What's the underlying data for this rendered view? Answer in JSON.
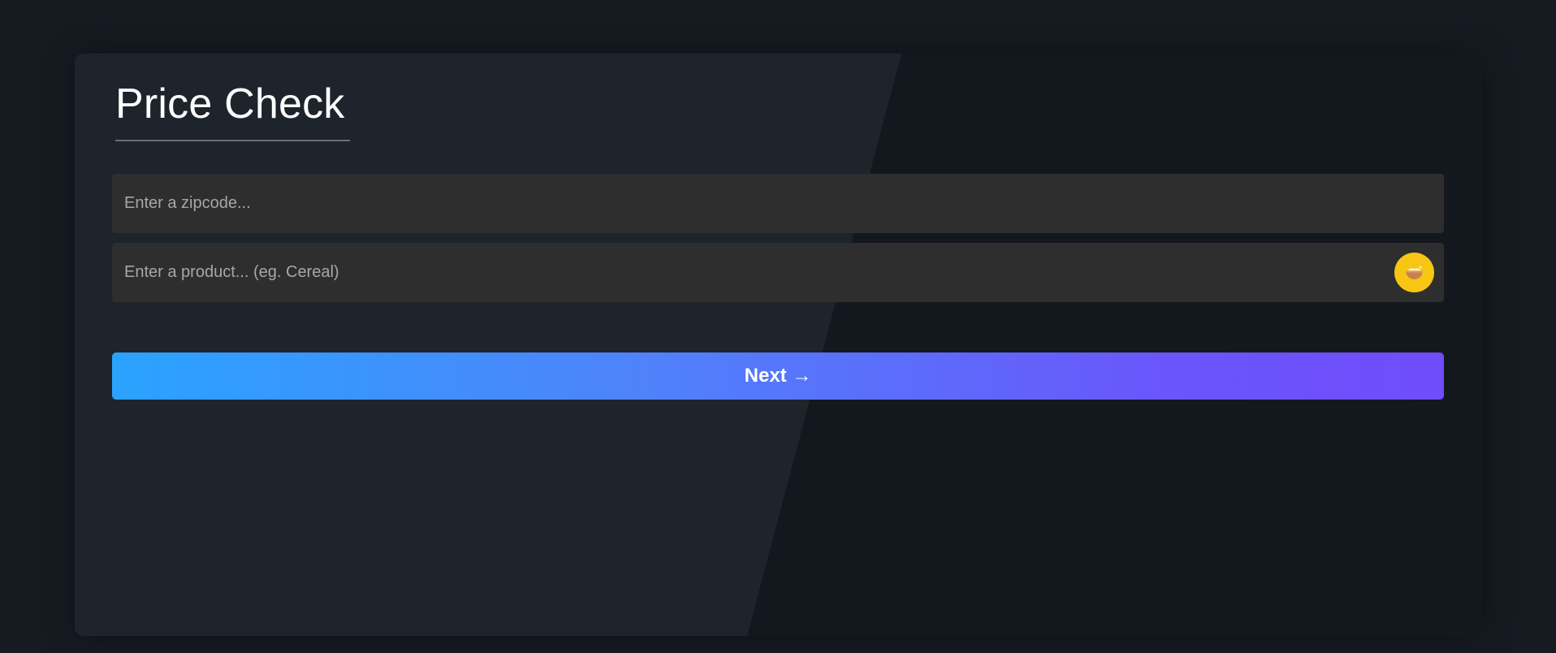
{
  "app": {
    "title": "Price Check"
  },
  "form": {
    "zipcode": {
      "value": "",
      "placeholder": "Enter a zipcode..."
    },
    "product": {
      "value": "",
      "placeholder": "Enter a product... (eg. Cereal)",
      "action_icon": "bowl-icon"
    },
    "next_label": "Next →"
  },
  "colors": {
    "background": "#161b22",
    "card_panel": "#1e242b",
    "input_background": "#2e2e2e",
    "icon_button": "#f7c613",
    "gradient_start": "#2aa3fe",
    "gradient_end": "#704cfb"
  }
}
